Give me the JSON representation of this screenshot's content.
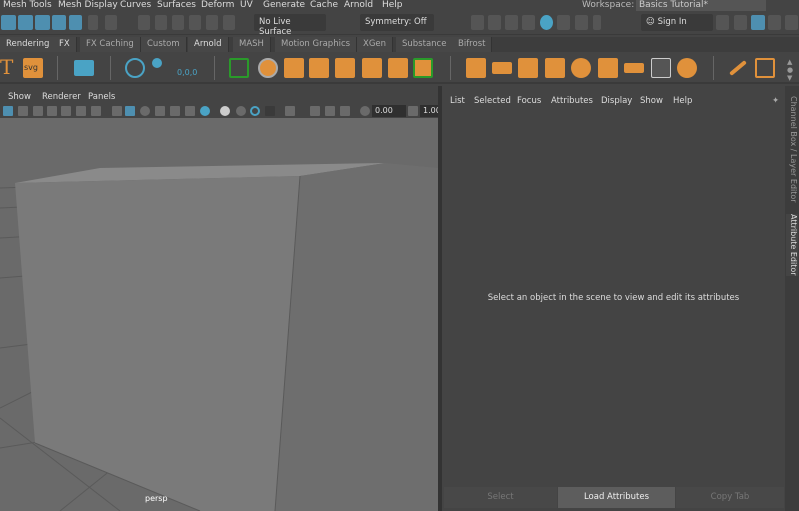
{
  "menubar": [
    "Mesh Tools",
    "Mesh Display",
    "Curves",
    "Surfaces",
    "Deform",
    "UV",
    "Generate",
    "Cache",
    "Arnold",
    "Help"
  ],
  "workspace": {
    "label": "Workspace:",
    "value": "Basics Tutorial*"
  },
  "toolbar": {
    "live_surface": "No Live Surface",
    "symmetry": "Symmetry: Off",
    "sign_in": "Sign In"
  },
  "shelf_tabs": [
    "Rendering",
    "FX",
    "FX Caching",
    "Custom",
    "Arnold",
    "MASH",
    "Motion Graphics",
    "XGen",
    "Substance",
    "Bifrost"
  ],
  "shelf": {
    "text_icon": "T",
    "svg_icon": "svg",
    "coords": "0,0,0"
  },
  "viewport": {
    "menu": [
      "Show",
      "Renderer",
      "Panels"
    ],
    "field1": "0.00",
    "field2": "1.00",
    "camera": "persp"
  },
  "attribute_editor": {
    "menu": [
      "List",
      "Selected",
      "Focus",
      "Attributes",
      "Display",
      "Show",
      "Help"
    ],
    "message": "Select an object in the scene to view and edit its attributes",
    "buttons": {
      "select": "Select",
      "load": "Load Attributes",
      "copy": "Copy Tab"
    }
  },
  "side_tabs": {
    "channel_box": "Channel Box / Layer Editor",
    "attribute_editor": "Attribute Editor"
  }
}
